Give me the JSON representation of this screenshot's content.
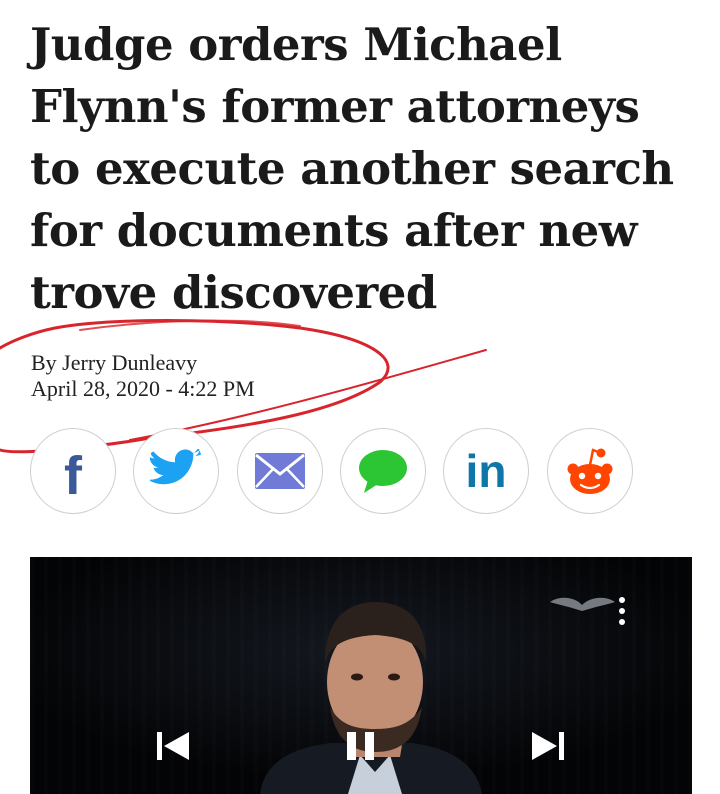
{
  "article": {
    "headline": "Judge orders Michael Flynn's former attorneys to execute another search for documents after new trove discovered",
    "byline": "By Jerry Dunleavy",
    "date": "April 28, 2020 - 4:22 PM"
  },
  "share_buttons": [
    {
      "name": "facebook",
      "icon": "facebook-icon",
      "color": "#3b5998",
      "glyph": "f"
    },
    {
      "name": "twitter",
      "icon": "twitter-icon",
      "color": "#1da1f2"
    },
    {
      "name": "email",
      "icon": "envelope-icon",
      "color": "#6f7bd6"
    },
    {
      "name": "sms",
      "icon": "chat-bubble-icon",
      "color": "#2cc533"
    },
    {
      "name": "linkedin",
      "icon": "linkedin-icon",
      "color": "#0e76a8",
      "glyph": "in"
    },
    {
      "name": "reddit",
      "icon": "reddit-icon",
      "color": "#ff4500"
    }
  ],
  "video": {
    "controls": [
      "previous-icon",
      "pause-icon",
      "next-icon",
      "more-options-icon"
    ]
  },
  "colors": {
    "annotation": "#d8252c",
    "video_bg": "#020202"
  }
}
